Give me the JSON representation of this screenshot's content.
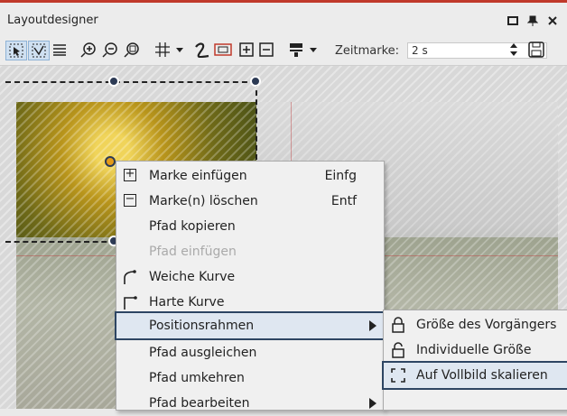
{
  "window": {
    "title": "Layoutdesigner",
    "buttons": {
      "restore": "□",
      "pin": "ᵖ",
      "close": "✕"
    }
  },
  "toolbar": {
    "time_label": "Zeitmarke:",
    "time_value": "2 s",
    "icons": [
      "select-tool-icon",
      "curve-tool-icon",
      "lines-icon",
      "zoom-in-icon",
      "zoom-out-icon",
      "zoom-fit-icon",
      "grid-icon",
      "grid-dropdown-icon",
      "path-icon",
      "frame-icon",
      "add-marker-icon",
      "remove-marker-icon",
      "layout-icon",
      "layout-dropdown-icon",
      "spinner-icon",
      "save-icon"
    ]
  },
  "context_menu": {
    "items": [
      {
        "label": "Marke einfügen",
        "shortcut": "Einfg",
        "icon": "plus-box-icon"
      },
      {
        "label": "Marke(n) löschen",
        "shortcut": "Entf",
        "icon": "minus-box-icon"
      },
      {
        "label": "Pfad kopieren"
      },
      {
        "label": "Pfad einfügen",
        "disabled": true
      },
      {
        "label": "Weiche Kurve",
        "icon": "soft-curve-icon"
      },
      {
        "label": "Harte Kurve",
        "icon": "hard-curve-icon"
      },
      {
        "label": "Positionsrahmen",
        "submenu": true,
        "active": true
      },
      {
        "label": "Pfad ausgleichen"
      },
      {
        "label": "Pfad umkehren"
      },
      {
        "label": "Pfad bearbeiten",
        "submenu": true
      }
    ]
  },
  "submenu": {
    "items": [
      {
        "label": "Größe des Vorgängers",
        "icon": "lock-icon"
      },
      {
        "label": "Individuelle Größe",
        "icon": "unlock-icon"
      },
      {
        "label": "Auf Vollbild skalieren",
        "icon": "fullscreen-icon",
        "active": true
      }
    ]
  }
}
